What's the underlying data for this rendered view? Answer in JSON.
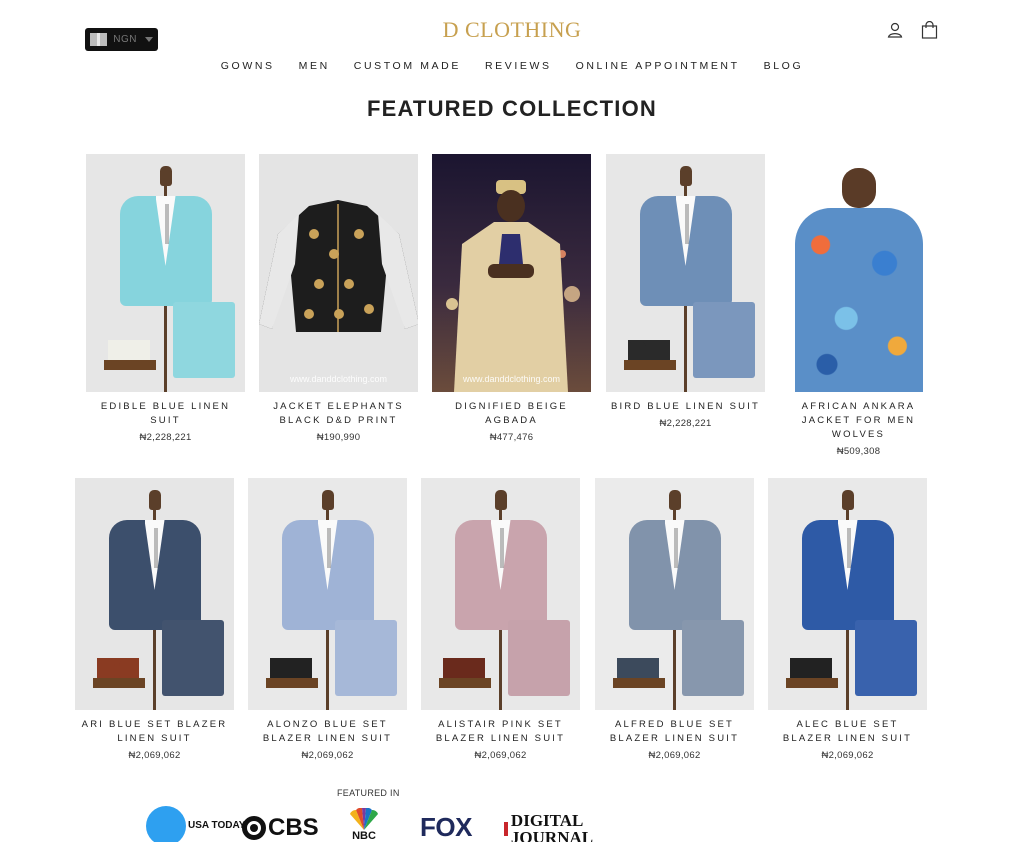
{
  "header": {
    "brand": "D CLOTHING",
    "currency": "NGN",
    "icons": [
      "user-icon",
      "bag-icon"
    ]
  },
  "nav": [
    "GOWNS",
    "MEN",
    "CUSTOM MADE",
    "REVIEWS",
    "ONLINE APPOINTMENT",
    "BLOG"
  ],
  "section_title": "FEATURED COLLECTION",
  "products": [
    {
      "name": "EDIBLE BLUE LINEN SUIT",
      "price": "₦2,228,221",
      "jacket_color": "#86d4dd",
      "trouser_color": "#8fd7df",
      "shoe_color": "#efefe8",
      "watermark": ""
    },
    {
      "name": "JACKET ELEPHANTS BLACK D&D PRINT",
      "price": "₦190,990",
      "watermark": "www.danddclothing.com"
    },
    {
      "name": "DIGNIFIED BEIGE AGBADA",
      "price": "₦477,476",
      "watermark": "www.danddclothing.com"
    },
    {
      "name": "BIRD BLUE LINEN SUIT",
      "price": "₦2,228,221",
      "jacket_color": "#6e8fb7",
      "trouser_color": "#7b97bd",
      "shoe_color": "#2a2a2a",
      "watermark": ""
    },
    {
      "name": "AFRICAN ANKARA JACKET FOR MEN WOLVES",
      "price": "₦509,308",
      "watermark": ""
    },
    {
      "name": "ARI BLUE SET BLAZER LINEN SUIT",
      "price": "₦2,069,062",
      "jacket_color": "#3c4f6c",
      "trouser_color": "#42536e",
      "shoe_color": "#8a3b22",
      "watermark": ""
    },
    {
      "name": "ALONZO BLUE SET BLAZER LINEN SUIT",
      "price": "₦2,069,062",
      "jacket_color": "#9fb3d6",
      "trouser_color": "#a6b8d8",
      "shoe_color": "#222222",
      "watermark": ""
    },
    {
      "name": "ALISTAIR PINK SET BLAZER LINEN SUIT",
      "price": "₦2,069,062",
      "jacket_color": "#c9a4ad",
      "trouser_color": "#c6a2ab",
      "shoe_color": "#6a2a1c",
      "watermark": ""
    },
    {
      "name": "ALFRED BLUE SET BLAZER LINEN SUIT",
      "price": "₦2,069,062",
      "jacket_color": "#8193ab",
      "trouser_color": "#8797ad",
      "shoe_color": "#3c4a5c",
      "watermark": ""
    },
    {
      "name": "ALEC BLUE SET BLAZER LINEN SUIT",
      "price": "₦2,069,062",
      "jacket_color": "#2e5aa6",
      "trouser_color": "#3962ad",
      "shoe_color": "#222222",
      "watermark": ""
    }
  ],
  "featured_in": {
    "label": "FEATURED IN",
    "logos": [
      {
        "name": "usa-today-logo",
        "text": "USA TODAY"
      },
      {
        "name": "cbs-logo",
        "text": "CBS"
      },
      {
        "name": "nbc-logo",
        "text": "NBC"
      },
      {
        "name": "fox-logo",
        "text": "FOX"
      },
      {
        "name": "digital-journal-logo",
        "text": "DIGITAL JOURNAL"
      }
    ]
  }
}
